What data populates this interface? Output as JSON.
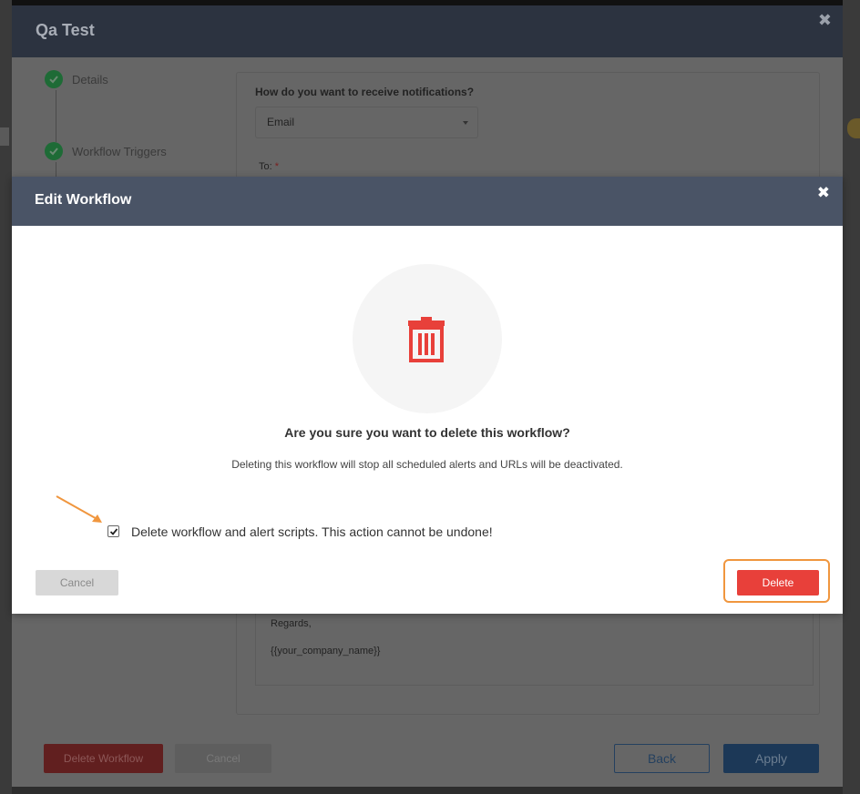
{
  "outer_modal": {
    "title": "Qa Test",
    "close_glyph": "✖",
    "steps": [
      {
        "label": "Details",
        "status": "complete"
      },
      {
        "label": "Workflow Triggers",
        "status": "complete"
      }
    ],
    "form": {
      "notify_question": "How do you want to receive notifications?",
      "notify_method": "Email",
      "to_label": "To:",
      "required_marker": "*",
      "message_regards": "Regards,",
      "message_company": "{{your_company_name}}"
    },
    "footer": {
      "delete_workflow_label": "Delete Workflow",
      "cancel_label": "Cancel",
      "back_label": "Back",
      "apply_label": "Apply"
    }
  },
  "dialog": {
    "title": "Edit Workflow",
    "close_glyph": "✖",
    "icon": "trash-icon",
    "question": "Are you sure you want to delete this workflow?",
    "description": "Deleting this workflow will stop all scheduled alerts and URLs will be deactivated.",
    "checkbox_checked": true,
    "checkbox_label": "Delete workflow and alert scripts. This action cannot be undone!",
    "cancel_label": "Cancel",
    "delete_label": "Delete"
  },
  "colors": {
    "delete_red": "#e8403a",
    "highlight_orange": "#f0963e",
    "header_slate": "#4a5466",
    "step_green": "#1e6b36"
  }
}
